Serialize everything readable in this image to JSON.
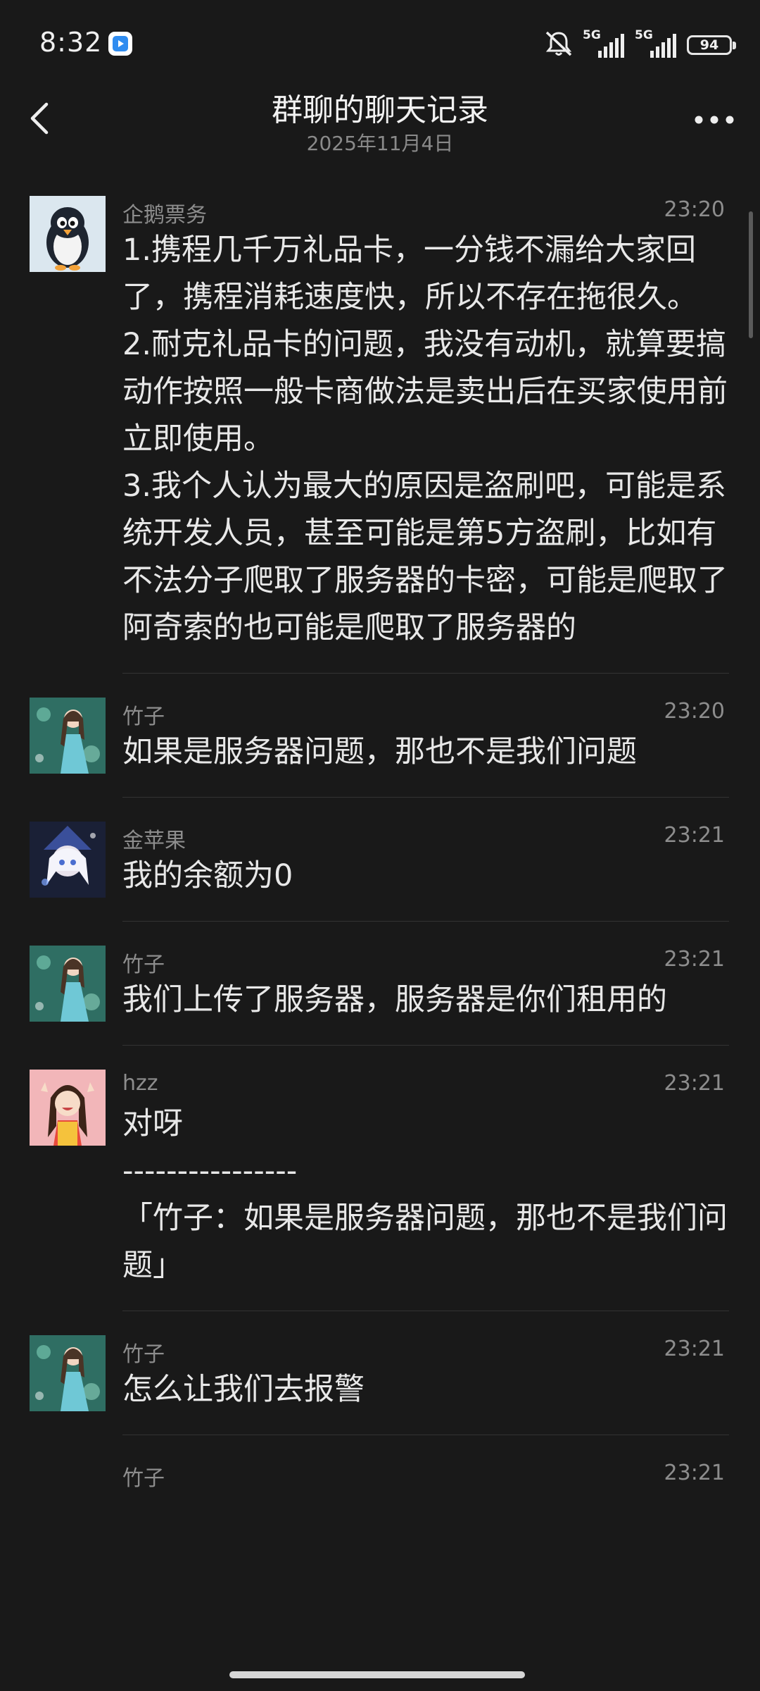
{
  "status_bar": {
    "time": "8:32",
    "network1": "5G",
    "network2": "5G",
    "battery": "94"
  },
  "header": {
    "title": "群聊的聊天记录",
    "date": "2025年11月4日"
  },
  "messages": [
    {
      "sender": "企鹅票务",
      "time": "23:20",
      "avatar": "penguin-avatar",
      "text": "1.携程几千万礼品卡，一分钱不漏给大家回了，携程消耗速度快，所以不存在拖很久。\n2.耐克礼品卡的问题，我没有动机，就算要搞动作按照一般卡商做法是卖出后在买家使用前立即使用。\n3.我个人认为最大的原因是盗刷吧，可能是系统开发人员，甚至可能是第5方盗刷，比如有不法分子爬取了服务器的卡密，可能是爬取了阿奇索的也可能是爬取了服务器的"
    },
    {
      "sender": "竹子",
      "time": "23:20",
      "avatar": "girl-green-avatar",
      "text": "如果是服务器问题，那也不是我们问题"
    },
    {
      "sender": "金苹果",
      "time": "23:21",
      "avatar": "anime-blue-avatar",
      "text": "我的余额为0"
    },
    {
      "sender": "竹子",
      "time": "23:21",
      "avatar": "girl-green-avatar",
      "text": "我们上传了服务器，服务器是你们租用的"
    },
    {
      "sender": "hzz",
      "time": "23:21",
      "avatar": "girl-pink-avatar",
      "text": "对呀\n----------------\n「竹子：如果是服务器问题，那也不是我们问题」"
    },
    {
      "sender": "竹子",
      "time": "23:21",
      "avatar": "girl-green-avatar",
      "text": "怎么让我们去报警"
    },
    {
      "sender": "竹子",
      "time": "23:21",
      "avatar": "girl-green-avatar",
      "text": ""
    }
  ]
}
